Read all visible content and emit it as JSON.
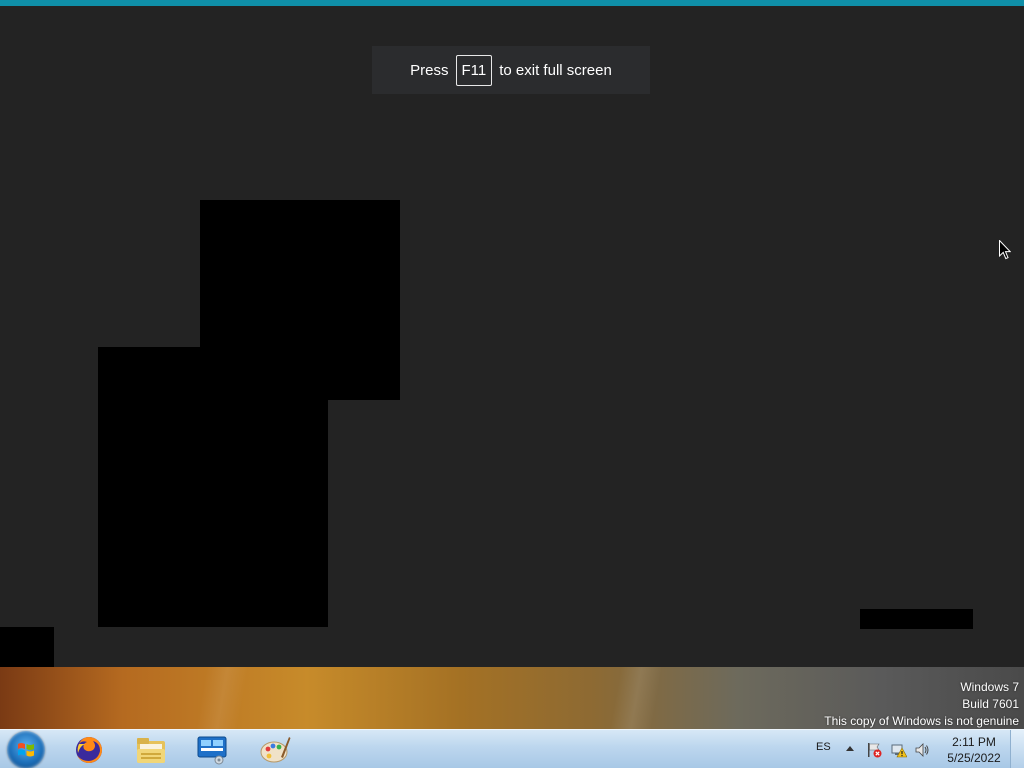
{
  "fullscreen_notice": {
    "prefix": "Press",
    "key": "F11",
    "suffix": "to exit full screen"
  },
  "watermark": {
    "line1": "Windows 7",
    "line2": "Build 7601",
    "line3": "This copy of Windows is not genuine"
  },
  "taskbar": {
    "start_icon": "windows-start-orb",
    "pinned": [
      {
        "name": "firefox",
        "icon": "firefox-icon"
      },
      {
        "name": "file-explorer",
        "icon": "folder-icon"
      },
      {
        "name": "control-panel",
        "icon": "control-panel-icon"
      },
      {
        "name": "paint",
        "icon": "paint-palette-icon"
      }
    ],
    "tray": {
      "language": "ES",
      "time": "2:11 PM",
      "date": "5/25/2022"
    }
  },
  "colors": {
    "accent": "#0f8fa8",
    "background": "#232323",
    "taskbar": "#bcd6ee"
  }
}
